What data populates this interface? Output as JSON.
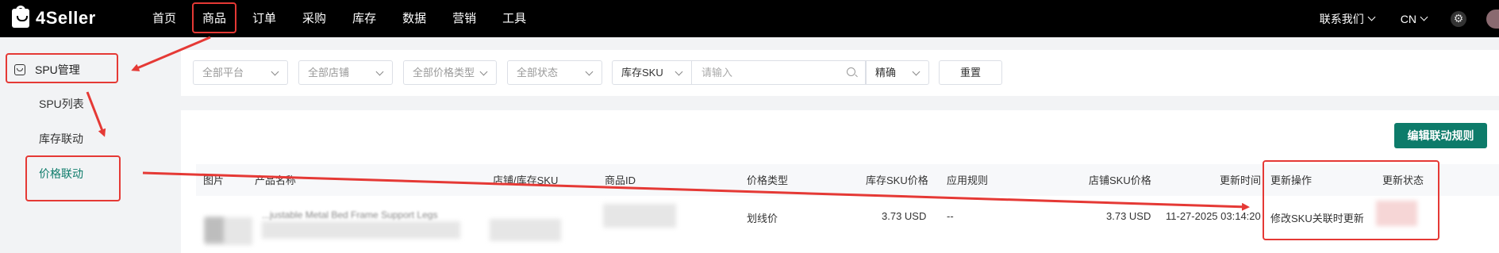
{
  "header": {
    "logo_text": "4Seller",
    "nav": [
      "首页",
      "商品",
      "订单",
      "采购",
      "库存",
      "数据",
      "营销",
      "工具"
    ],
    "contact_label": "联系我们",
    "lang_label": "CN"
  },
  "sidebar": {
    "parent_label": "SPU管理",
    "items": [
      {
        "label": "SPU列表",
        "active": false
      },
      {
        "label": "库存联动",
        "active": false
      },
      {
        "label": "价格联动",
        "active": true
      }
    ]
  },
  "filters": {
    "platform": "全部平台",
    "store": "全部店铺",
    "price_type": "全部价格类型",
    "status": "全部状态",
    "search_field": "库存SKU",
    "search_placeholder": "请输入",
    "match_mode": "精确",
    "reset_label": "重置"
  },
  "actions": {
    "edit_rules_label": "编辑联动规则"
  },
  "table": {
    "headers": [
      "图片",
      "产品名称",
      "店铺/库存SKU",
      "商品ID",
      "价格类型",
      "库存SKU价格",
      "应用规则",
      "店铺SKU价格",
      "更新时间",
      "更新操作",
      "更新状态"
    ],
    "rows": [
      {
        "product_name_visible": "...justable Metal Bed Frame Support Legs",
        "price_type": "划线价",
        "stock_sku_price": "3.73 USD",
        "applied_rule": "--",
        "store_sku_price": "3.73 USD",
        "updated_at": "11-27-2025 03:14:20",
        "update_action": "修改SKU关联时更新"
      }
    ]
  },
  "colors": {
    "accent": "#0d7b6a",
    "annotation": "#e53935",
    "topbar": "#000000"
  }
}
